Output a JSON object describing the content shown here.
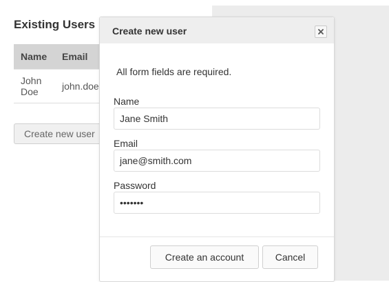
{
  "page": {
    "heading": "Existing Users",
    "table": {
      "headers": [
        "Name",
        "Email"
      ],
      "rows": [
        {
          "name": "John Doe",
          "email": "john.doe@example.com"
        }
      ]
    },
    "create_button": "Create new user"
  },
  "modal": {
    "title": "Create new user",
    "close_icon": "close-x-icon",
    "intro": "All form fields are required.",
    "fields": {
      "name": {
        "label": "Name",
        "value": "Jane Smith"
      },
      "email": {
        "label": "Email",
        "value": "jane@smith.com"
      },
      "password": {
        "label": "Password",
        "value": "•••••••"
      }
    },
    "buttons": {
      "create": "Create an account",
      "cancel": "Cancel"
    }
  }
}
